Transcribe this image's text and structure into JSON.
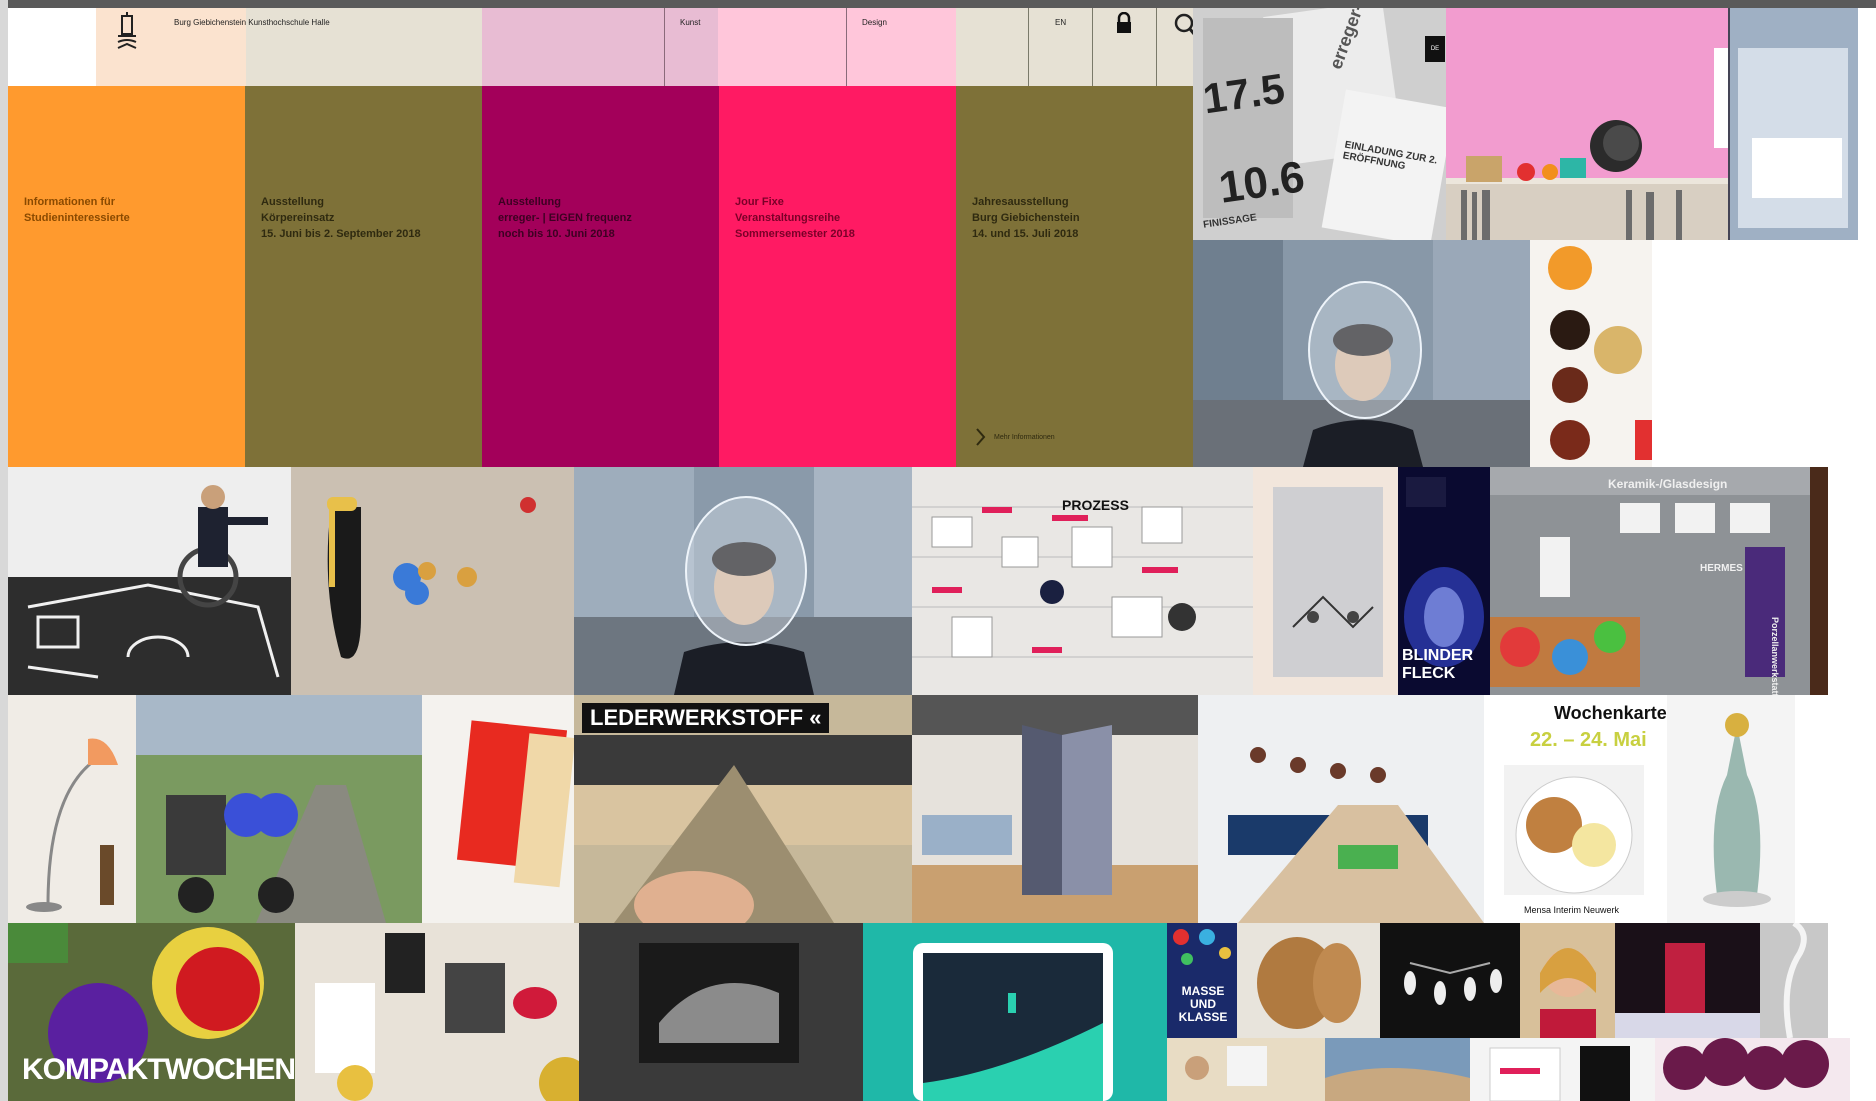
{
  "header": {
    "logo_text": "Burg Giebichenstein Kunsthochschule Halle",
    "nav_kunst": "Kunst",
    "nav_design": "Design",
    "lang": "EN",
    "badge": "DE"
  },
  "panels": [
    {
      "text": "Informationen für\nStudieninteressierte",
      "color": "#ff9a2e",
      "text_color": "#8a4a00"
    },
    {
      "text": "Ausstellung\nKörpereinsatz\n15. Juni bis 2. September 2018",
      "color": "#7e7138",
      "text_color": "#2f2a10"
    },
    {
      "text": "Ausstellung\nerreger- | EIGEN frequenz\nnoch bis 10. Juni 2018",
      "color": "#a3005a",
      "text_color": "#3d0022"
    },
    {
      "text": "Jour Fixe\nVeranstaltungsreihe\nSommersemester 2018",
      "color": "#ff1a63",
      "text_color": "#7a0028"
    },
    {
      "text": "Jahresausstellung\nBurg Giebichenstein\n14. und 15. Juli 2018",
      "color": "#7e7138",
      "text_color": "#2f2a10"
    }
  ],
  "more_info": "Mehr Informationen",
  "tile_texts": {
    "poster_17": "17.5",
    "poster_10": "10.6",
    "poster_erreger": "erreger-",
    "poster_einladung": "EINLADUNG ZUR 2. ERÖFFNUNG",
    "poster_finissage": "FINISSAGE",
    "prozess": "PROZESS",
    "keramik": "Keramik-/Glasdesign",
    "porzellan": "Porzellanwerkstatt",
    "hermes": "HERMES",
    "blinder": "BLINDER FLECK",
    "lederwerkstoff": "LEDERWERKSTOFF «",
    "wochenkarte": "Wochenkarte",
    "wochen_date": "22. – 24. Mai",
    "mensa": "Mensa Interim Neuwerk",
    "kompakt": "KOMPAKTWOCHEN",
    "masse": "MASSE UND KLASSE"
  },
  "colors": {
    "orange": "#ff9a2e",
    "olive": "#7e7138",
    "magenta": "#a3005a",
    "pink": "#ff1a63",
    "teal": "#1fb8a8"
  },
  "icons": [
    "logo-icon",
    "lock-icon",
    "search-icon"
  ]
}
